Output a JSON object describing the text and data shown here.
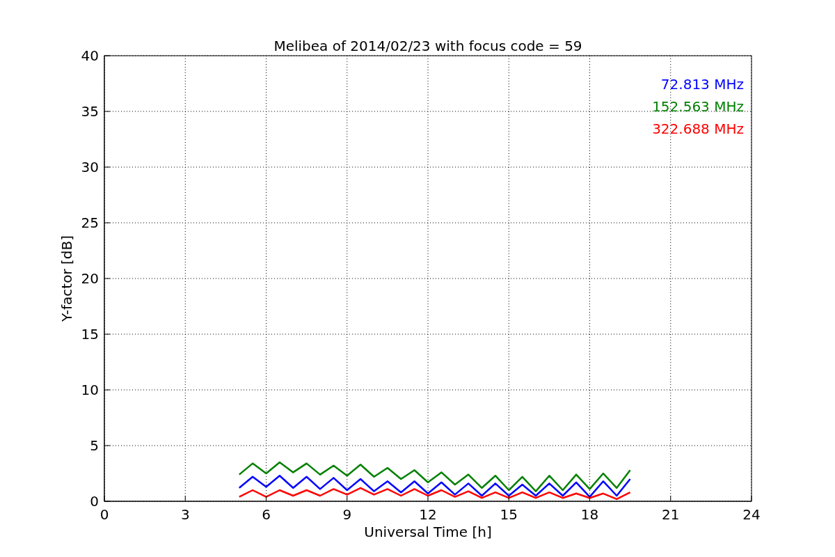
{
  "figure": {
    "chart_data": {
      "type": "line",
      "title": "Melibea of 2014/02/23 with focus code = 59",
      "xlabel": "Universal Time [h]",
      "ylabel": "Y-factor [dB]",
      "x": [
        5.0,
        5.5,
        6.0,
        6.5,
        7.0,
        7.5,
        8.0,
        8.5,
        9.0,
        9.5,
        10.0,
        10.5,
        11.0,
        11.5,
        12.0,
        12.5,
        13.0,
        13.5,
        14.0,
        14.5,
        15.0,
        15.5,
        16.0,
        16.5,
        17.0,
        17.5,
        18.0,
        18.5,
        19.0,
        19.5
      ],
      "series": [
        {
          "name": "72.813 MHz",
          "color": "#0000ff",
          "values": [
            1.2,
            2.2,
            1.3,
            2.3,
            1.2,
            2.2,
            1.1,
            2.1,
            1.0,
            2.0,
            0.9,
            1.8,
            0.8,
            1.8,
            0.7,
            1.7,
            0.6,
            1.6,
            0.5,
            1.6,
            0.5,
            1.5,
            0.5,
            1.6,
            0.5,
            1.7,
            0.4,
            1.8,
            0.5,
            2.0
          ]
        },
        {
          "name": "152.563 MHz",
          "color": "#008000",
          "values": [
            2.4,
            3.4,
            2.5,
            3.5,
            2.6,
            3.4,
            2.4,
            3.2,
            2.3,
            3.3,
            2.2,
            3.0,
            2.0,
            2.8,
            1.7,
            2.6,
            1.5,
            2.4,
            1.2,
            2.3,
            1.0,
            2.2,
            0.9,
            2.3,
            1.0,
            2.4,
            1.1,
            2.5,
            1.2,
            2.8
          ]
        },
        {
          "name": "322.688 MHz",
          "color": "#ff0000",
          "values": [
            0.4,
            1.0,
            0.4,
            1.0,
            0.5,
            1.0,
            0.5,
            1.1,
            0.6,
            1.2,
            0.6,
            1.1,
            0.5,
            1.1,
            0.5,
            1.0,
            0.4,
            0.9,
            0.3,
            0.8,
            0.3,
            0.8,
            0.3,
            0.8,
            0.3,
            0.7,
            0.3,
            0.7,
            0.2,
            0.8
          ]
        }
      ],
      "grid": true,
      "xlim": [
        0,
        24
      ],
      "ylim": [
        0,
        40
      ],
      "xticks": [
        0,
        3,
        6,
        9,
        12,
        15,
        18,
        21,
        24
      ],
      "yticks": [
        0,
        5,
        10,
        15,
        20,
        25,
        30,
        35,
        40
      ]
    }
  }
}
